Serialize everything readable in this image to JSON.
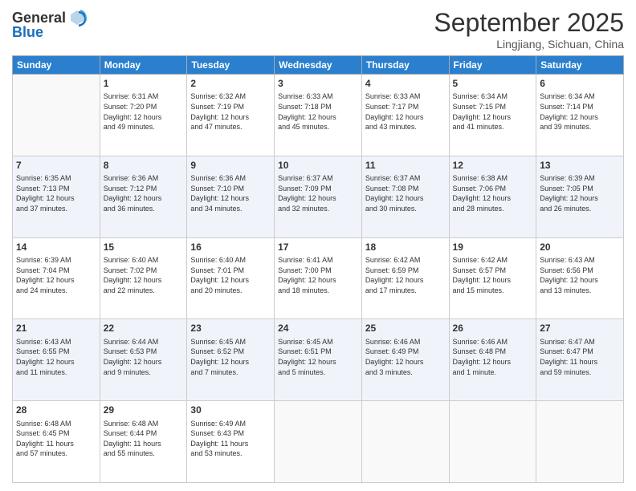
{
  "header": {
    "logo_general": "General",
    "logo_blue": "Blue",
    "month": "September 2025",
    "location": "Lingjiang, Sichuan, China"
  },
  "days_of_week": [
    "Sunday",
    "Monday",
    "Tuesday",
    "Wednesday",
    "Thursday",
    "Friday",
    "Saturday"
  ],
  "weeks": [
    [
      {
        "day": "",
        "info": ""
      },
      {
        "day": "1",
        "info": "Sunrise: 6:31 AM\nSunset: 7:20 PM\nDaylight: 12 hours\nand 49 minutes."
      },
      {
        "day": "2",
        "info": "Sunrise: 6:32 AM\nSunset: 7:19 PM\nDaylight: 12 hours\nand 47 minutes."
      },
      {
        "day": "3",
        "info": "Sunrise: 6:33 AM\nSunset: 7:18 PM\nDaylight: 12 hours\nand 45 minutes."
      },
      {
        "day": "4",
        "info": "Sunrise: 6:33 AM\nSunset: 7:17 PM\nDaylight: 12 hours\nand 43 minutes."
      },
      {
        "day": "5",
        "info": "Sunrise: 6:34 AM\nSunset: 7:15 PM\nDaylight: 12 hours\nand 41 minutes."
      },
      {
        "day": "6",
        "info": "Sunrise: 6:34 AM\nSunset: 7:14 PM\nDaylight: 12 hours\nand 39 minutes."
      }
    ],
    [
      {
        "day": "7",
        "info": "Sunrise: 6:35 AM\nSunset: 7:13 PM\nDaylight: 12 hours\nand 37 minutes."
      },
      {
        "day": "8",
        "info": "Sunrise: 6:36 AM\nSunset: 7:12 PM\nDaylight: 12 hours\nand 36 minutes."
      },
      {
        "day": "9",
        "info": "Sunrise: 6:36 AM\nSunset: 7:10 PM\nDaylight: 12 hours\nand 34 minutes."
      },
      {
        "day": "10",
        "info": "Sunrise: 6:37 AM\nSunset: 7:09 PM\nDaylight: 12 hours\nand 32 minutes."
      },
      {
        "day": "11",
        "info": "Sunrise: 6:37 AM\nSunset: 7:08 PM\nDaylight: 12 hours\nand 30 minutes."
      },
      {
        "day": "12",
        "info": "Sunrise: 6:38 AM\nSunset: 7:06 PM\nDaylight: 12 hours\nand 28 minutes."
      },
      {
        "day": "13",
        "info": "Sunrise: 6:39 AM\nSunset: 7:05 PM\nDaylight: 12 hours\nand 26 minutes."
      }
    ],
    [
      {
        "day": "14",
        "info": "Sunrise: 6:39 AM\nSunset: 7:04 PM\nDaylight: 12 hours\nand 24 minutes."
      },
      {
        "day": "15",
        "info": "Sunrise: 6:40 AM\nSunset: 7:02 PM\nDaylight: 12 hours\nand 22 minutes."
      },
      {
        "day": "16",
        "info": "Sunrise: 6:40 AM\nSunset: 7:01 PM\nDaylight: 12 hours\nand 20 minutes."
      },
      {
        "day": "17",
        "info": "Sunrise: 6:41 AM\nSunset: 7:00 PM\nDaylight: 12 hours\nand 18 minutes."
      },
      {
        "day": "18",
        "info": "Sunrise: 6:42 AM\nSunset: 6:59 PM\nDaylight: 12 hours\nand 17 minutes."
      },
      {
        "day": "19",
        "info": "Sunrise: 6:42 AM\nSunset: 6:57 PM\nDaylight: 12 hours\nand 15 minutes."
      },
      {
        "day": "20",
        "info": "Sunrise: 6:43 AM\nSunset: 6:56 PM\nDaylight: 12 hours\nand 13 minutes."
      }
    ],
    [
      {
        "day": "21",
        "info": "Sunrise: 6:43 AM\nSunset: 6:55 PM\nDaylight: 12 hours\nand 11 minutes."
      },
      {
        "day": "22",
        "info": "Sunrise: 6:44 AM\nSunset: 6:53 PM\nDaylight: 12 hours\nand 9 minutes."
      },
      {
        "day": "23",
        "info": "Sunrise: 6:45 AM\nSunset: 6:52 PM\nDaylight: 12 hours\nand 7 minutes."
      },
      {
        "day": "24",
        "info": "Sunrise: 6:45 AM\nSunset: 6:51 PM\nDaylight: 12 hours\nand 5 minutes."
      },
      {
        "day": "25",
        "info": "Sunrise: 6:46 AM\nSunset: 6:49 PM\nDaylight: 12 hours\nand 3 minutes."
      },
      {
        "day": "26",
        "info": "Sunrise: 6:46 AM\nSunset: 6:48 PM\nDaylight: 12 hours\nand 1 minute."
      },
      {
        "day": "27",
        "info": "Sunrise: 6:47 AM\nSunset: 6:47 PM\nDaylight: 11 hours\nand 59 minutes."
      }
    ],
    [
      {
        "day": "28",
        "info": "Sunrise: 6:48 AM\nSunset: 6:45 PM\nDaylight: 11 hours\nand 57 minutes."
      },
      {
        "day": "29",
        "info": "Sunrise: 6:48 AM\nSunset: 6:44 PM\nDaylight: 11 hours\nand 55 minutes."
      },
      {
        "day": "30",
        "info": "Sunrise: 6:49 AM\nSunset: 6:43 PM\nDaylight: 11 hours\nand 53 minutes."
      },
      {
        "day": "",
        "info": ""
      },
      {
        "day": "",
        "info": ""
      },
      {
        "day": "",
        "info": ""
      },
      {
        "day": "",
        "info": ""
      }
    ]
  ]
}
